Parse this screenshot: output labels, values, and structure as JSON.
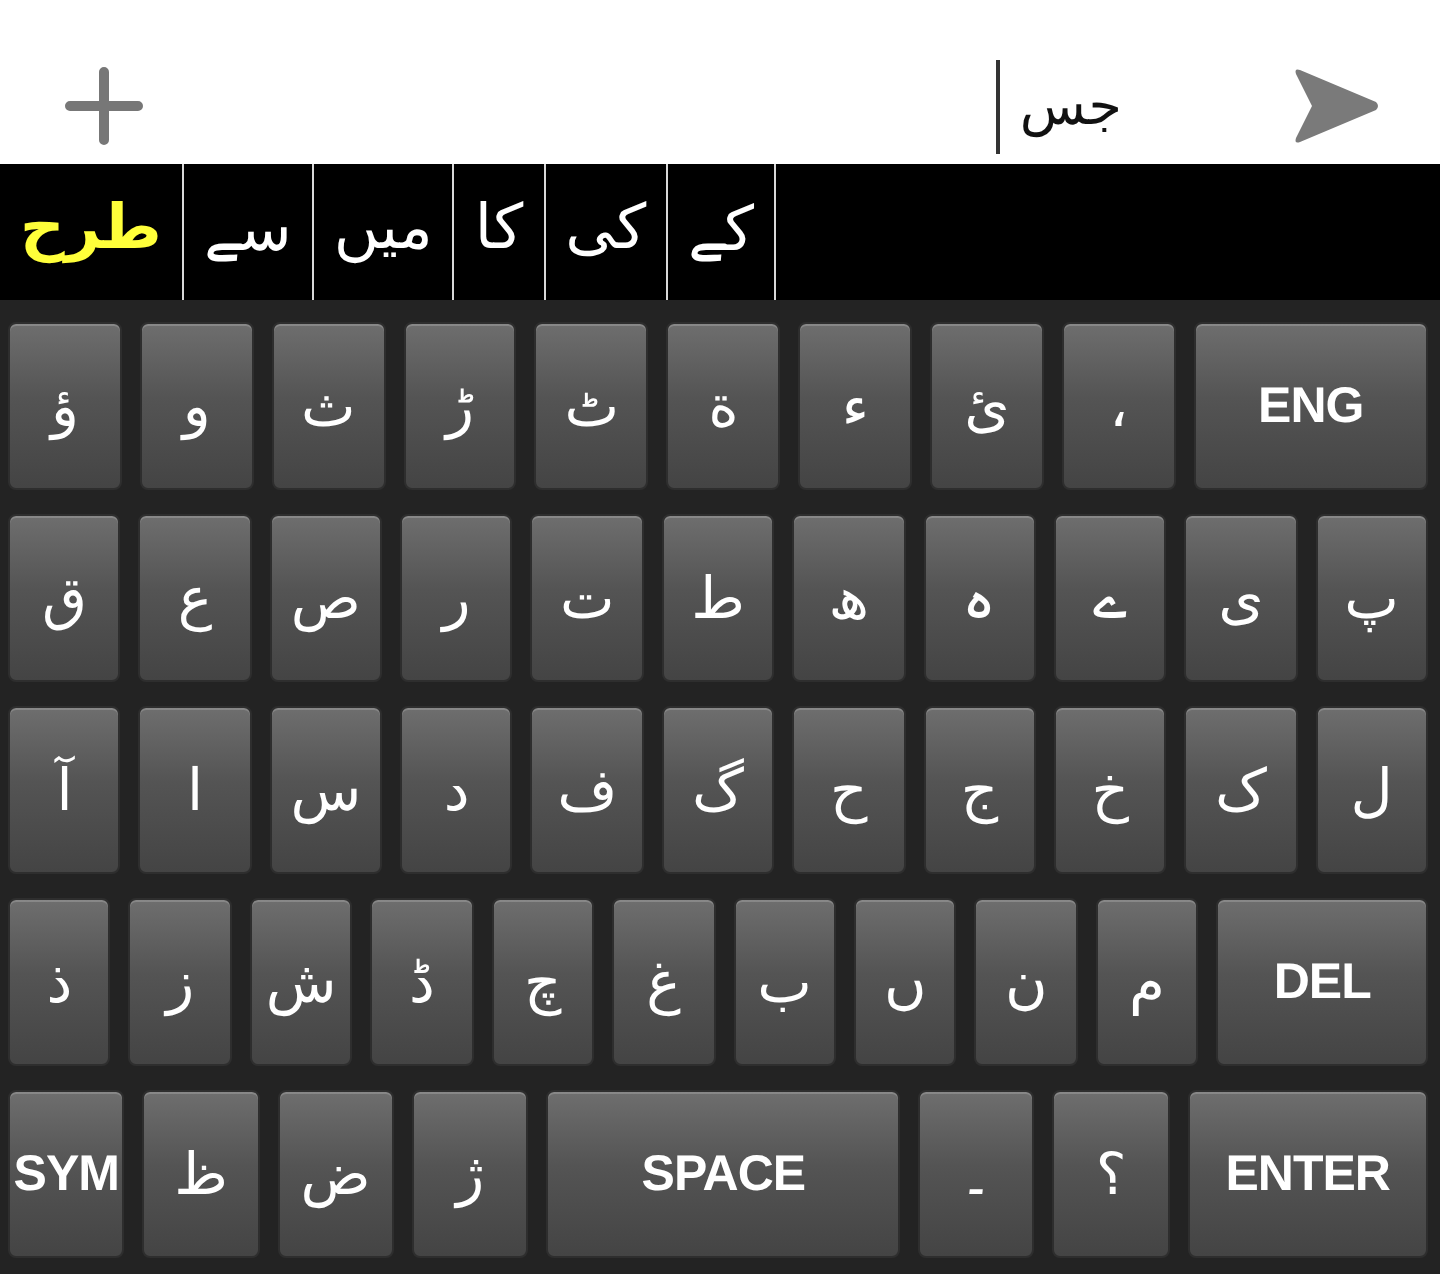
{
  "input_bar": {
    "value": "جس",
    "focused": true
  },
  "suggestions": [
    {
      "text": "کے",
      "selected": false
    },
    {
      "text": "کی",
      "selected": false
    },
    {
      "text": "کا",
      "selected": false
    },
    {
      "text": "میں",
      "selected": false
    },
    {
      "text": "سے",
      "selected": false
    },
    {
      "text": "طرح",
      "selected": true
    }
  ],
  "keyboard": {
    "rows": [
      {
        "keys": [
          {
            "kind": "action",
            "label": "ENG"
          },
          {
            "kind": "char",
            "label": "،"
          },
          {
            "kind": "char",
            "label": "ئ"
          },
          {
            "kind": "char",
            "label": "ء"
          },
          {
            "kind": "char",
            "label": "ة"
          },
          {
            "kind": "char",
            "label": "ٹ"
          },
          {
            "kind": "char",
            "label": "ڑ"
          },
          {
            "kind": "char",
            "label": "ث"
          },
          {
            "kind": "char",
            "label": "و"
          },
          {
            "kind": "char",
            "label": "ؤ"
          }
        ]
      },
      {
        "keys": [
          {
            "kind": "char",
            "label": "پ"
          },
          {
            "kind": "char",
            "label": "ی"
          },
          {
            "kind": "char",
            "label": "ے"
          },
          {
            "kind": "char",
            "label": "ہ"
          },
          {
            "kind": "char",
            "label": "ھ"
          },
          {
            "kind": "char",
            "label": "ط"
          },
          {
            "kind": "char",
            "label": "ت"
          },
          {
            "kind": "char",
            "label": "ر"
          },
          {
            "kind": "char",
            "label": "ص"
          },
          {
            "kind": "char",
            "label": "ع"
          },
          {
            "kind": "char",
            "label": "ق"
          }
        ]
      },
      {
        "keys": [
          {
            "kind": "char",
            "label": "ل"
          },
          {
            "kind": "char",
            "label": "ک"
          },
          {
            "kind": "char",
            "label": "خ"
          },
          {
            "kind": "char",
            "label": "ج"
          },
          {
            "kind": "char",
            "label": "ح"
          },
          {
            "kind": "char",
            "label": "گ"
          },
          {
            "kind": "char",
            "label": "ف"
          },
          {
            "kind": "char",
            "label": "د"
          },
          {
            "kind": "char",
            "label": "س"
          },
          {
            "kind": "char",
            "label": "ا"
          },
          {
            "kind": "char",
            "label": "آ"
          }
        ]
      },
      {
        "keys": [
          {
            "kind": "action",
            "label": "DEL"
          },
          {
            "kind": "char",
            "label": "م"
          },
          {
            "kind": "char",
            "label": "ن"
          },
          {
            "kind": "char",
            "label": "ں"
          },
          {
            "kind": "char",
            "label": "ب"
          },
          {
            "kind": "char",
            "label": "غ"
          },
          {
            "kind": "char",
            "label": "چ"
          },
          {
            "kind": "char",
            "label": "ڈ"
          },
          {
            "kind": "char",
            "label": "ش"
          },
          {
            "kind": "char",
            "label": "ز"
          },
          {
            "kind": "char",
            "label": "ذ"
          }
        ]
      },
      {
        "keys": [
          {
            "kind": "action",
            "label": "ENTER"
          },
          {
            "kind": "char",
            "label": "؟"
          },
          {
            "kind": "char",
            "label": "۔"
          },
          {
            "kind": "space",
            "label": "SPACE"
          },
          {
            "kind": "char",
            "label": "ژ"
          },
          {
            "kind": "char",
            "label": "ض"
          },
          {
            "kind": "char",
            "label": "ظ"
          },
          {
            "kind": "mode",
            "label": "SYM"
          }
        ]
      }
    ]
  }
}
